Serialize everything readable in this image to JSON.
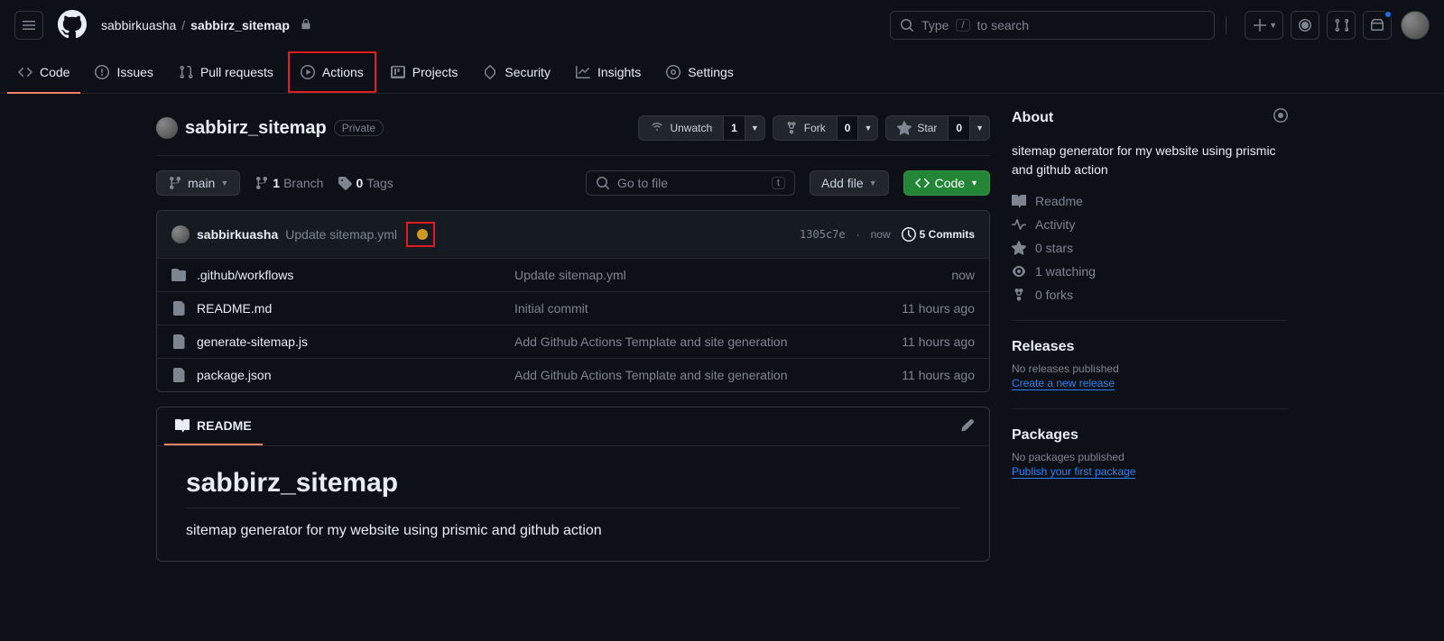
{
  "header": {
    "owner": "sabbirkuasha",
    "repo": "sabbirz_sitemap",
    "search_prefix": "Type",
    "search_key": "/",
    "search_suffix": "to search"
  },
  "nav": {
    "code": "Code",
    "issues": "Issues",
    "pulls": "Pull requests",
    "actions": "Actions",
    "projects": "Projects",
    "security": "Security",
    "insights": "Insights",
    "settings": "Settings"
  },
  "repo": {
    "name": "sabbirz_sitemap",
    "visibility": "Private"
  },
  "watch": {
    "label": "Unwatch",
    "count": "1"
  },
  "fork": {
    "label": "Fork",
    "count": "0"
  },
  "star": {
    "label": "Star",
    "count": "0"
  },
  "branch": {
    "name": "main",
    "count": "1",
    "label": "Branch"
  },
  "tags": {
    "count": "0",
    "label": "Tags"
  },
  "gotofile": {
    "placeholder": "Go to file",
    "key": "t"
  },
  "addfile": "Add file",
  "codebtn": "Code",
  "commit": {
    "user": "sabbirkuasha",
    "msg": "Update sitemap.yml",
    "sha": "1305c7e",
    "time": "now",
    "count": "5 Commits"
  },
  "files": [
    {
      "type": "dir",
      "name": ".github/workflows",
      "msg": "Update sitemap.yml",
      "time": "now"
    },
    {
      "type": "file",
      "name": "README.md",
      "msg": "Initial commit",
      "time": "11 hours ago"
    },
    {
      "type": "file",
      "name": "generate-sitemap.js",
      "msg": "Add Github Actions Template and site generation",
      "time": "11 hours ago"
    },
    {
      "type": "file",
      "name": "package.json",
      "msg": "Add Github Actions Template and site generation",
      "time": "11 hours ago"
    }
  ],
  "readme": {
    "tab": "README",
    "title": "sabbirz_sitemap",
    "body": "sitemap generator for my website using prismic and github action"
  },
  "about": {
    "title": "About",
    "desc": "sitemap generator for my website using prismic and github action",
    "readme": "Readme",
    "activity": "Activity",
    "stars": "0 stars",
    "watching": "1 watching",
    "forks": "0 forks"
  },
  "releases": {
    "title": "Releases",
    "empty": "No releases published",
    "link": "Create a new release"
  },
  "packages": {
    "title": "Packages",
    "empty": "No packages published",
    "link": "Publish your first package"
  }
}
